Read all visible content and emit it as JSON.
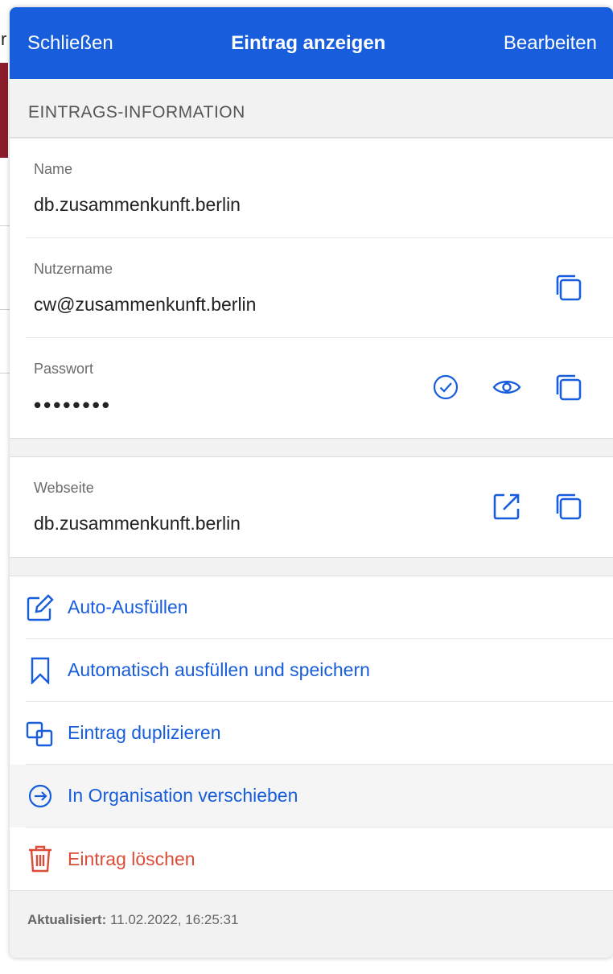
{
  "header": {
    "close_label": "Schließen",
    "title": "Eintrag anzeigen",
    "edit_label": "Bearbeiten"
  },
  "section": {
    "title": "EINTRAGS-INFORMATION"
  },
  "fields": {
    "name": {
      "label": "Name",
      "value": "db.zusammenkunft.berlin"
    },
    "username": {
      "label": "Nutzername",
      "value": "cw@zusammenkunft.berlin"
    },
    "password": {
      "label": "Passwort",
      "value": "••••••••"
    },
    "website": {
      "label": "Webseite",
      "value": "db.zusammenkunft.berlin"
    }
  },
  "actions": {
    "autofill": "Auto-Ausfüllen",
    "autofill_save": "Automatisch ausfüllen und speichern",
    "duplicate": "Eintrag duplizieren",
    "move_org": "In Organisation verschieben",
    "delete": "Eintrag löschen"
  },
  "footer": {
    "updated_label": "Aktualisiert:",
    "updated_value": "11.02.2022, 16:25:31"
  },
  "colors": {
    "accent": "#175ddc",
    "danger": "#dd4b39"
  },
  "icons": [
    "copy-icon",
    "check-circle-icon",
    "eye-icon",
    "launch-icon",
    "edit-icon",
    "bookmark-icon",
    "clone-icon",
    "arrow-circle-right-icon",
    "trash-icon"
  ]
}
